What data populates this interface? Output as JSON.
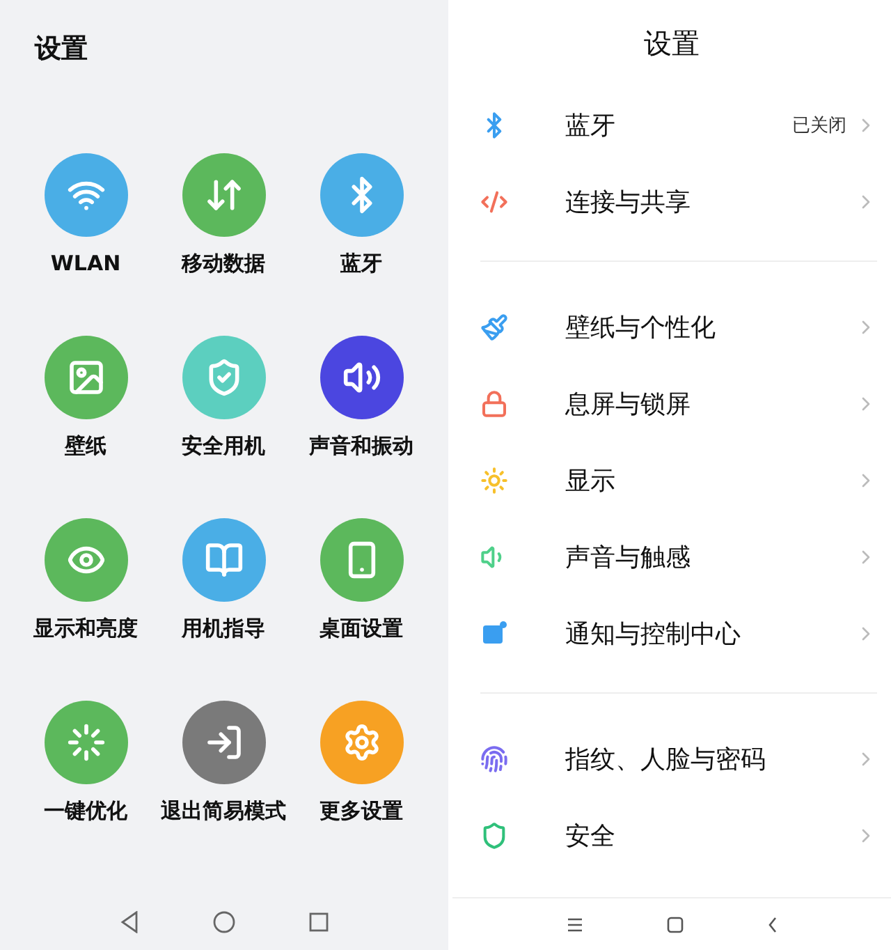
{
  "simple_mode": {
    "title": "设置",
    "tiles": [
      {
        "label": "WLAN",
        "color": "#4aaee6"
      },
      {
        "label": "移动数据",
        "color": "#5cb85c"
      },
      {
        "label": "蓝牙",
        "color": "#4aaee6"
      },
      {
        "label": "壁纸",
        "color": "#5cb85c"
      },
      {
        "label": "安全用机",
        "color": "#5ccfbf"
      },
      {
        "label": "声音和振动",
        "color": "#4b46e0"
      },
      {
        "label": "显示和亮度",
        "color": "#5cb85c"
      },
      {
        "label": "用机指导",
        "color": "#4aaee6"
      },
      {
        "label": "桌面设置",
        "color": "#5cb85c"
      },
      {
        "label": "一键优化",
        "color": "#5cb85c"
      },
      {
        "label": "退出简易模式",
        "color": "#7a7a7a"
      },
      {
        "label": "更多设置",
        "color": "#f7a123"
      }
    ]
  },
  "settings": {
    "title": "设置",
    "groups": [
      [
        {
          "label": "蓝牙",
          "value": "已关闭",
          "color": "#3a9ef0"
        },
        {
          "label": "连接与共享",
          "color": "#f2705a"
        }
      ],
      [
        {
          "label": "壁纸与个性化",
          "color": "#3a9ef0"
        },
        {
          "label": "息屏与锁屏",
          "color": "#f2705a"
        },
        {
          "label": "显示",
          "color": "#f7c02a"
        },
        {
          "label": "声音与触感",
          "color": "#4fd08a"
        },
        {
          "label": "通知与控制中心",
          "color": "#3a9ef0"
        }
      ],
      [
        {
          "label": "指纹、人脸与密码",
          "color": "#7a6cf0"
        },
        {
          "label": "安全",
          "color": "#2fc07a"
        }
      ]
    ]
  }
}
